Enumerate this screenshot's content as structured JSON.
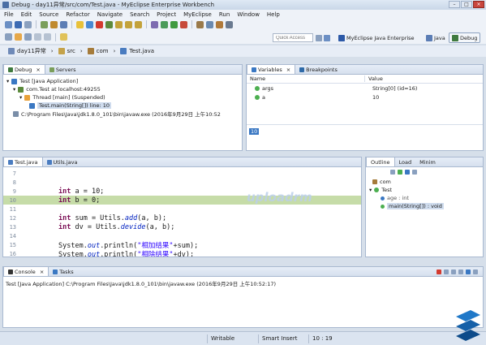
{
  "window": {
    "title": "Debug - day11异常/src/com/Test.java - MyEclipse Enterprise Workbench",
    "controls": [
      "–",
      "□",
      "×"
    ]
  },
  "menu": [
    "File",
    "Edit",
    "Source",
    "Refactor",
    "Navigate",
    "Search",
    "Project",
    "MyEclipse",
    "Run",
    "Window",
    "Help"
  ],
  "quick_access": {
    "placeholder": "Quick Access"
  },
  "perspectives": [
    {
      "label": "MyEclipse Java Enterprise"
    },
    {
      "label": "Java"
    },
    {
      "label": "Debug"
    }
  ],
  "breadcrumb": [
    "day11异常",
    "src",
    "com",
    "Test.java"
  ],
  "debug_view": {
    "tabs": [
      "Debug",
      "Servers"
    ],
    "tree": [
      {
        "label": "Test [Java Application]"
      },
      {
        "label": "com.Test at localhost:49255"
      },
      {
        "label": "Thread [main] (Suspended)"
      },
      {
        "label": "Test.main(String[]) line: 10"
      },
      {
        "label": "C:\\Program Files\\Java\\jdk1.8.0_101\\bin\\javaw.exe (2016年9月29日 上午10:52"
      }
    ]
  },
  "variables_view": {
    "tabs": [
      "Variables",
      "Breakpoints"
    ],
    "columns": [
      "Name",
      "Value"
    ],
    "rows": [
      {
        "name": "args",
        "value": "String[0]  (id=16)"
      },
      {
        "name": "a",
        "value": "10"
      }
    ],
    "detail_value": "10"
  },
  "editor": {
    "tabs": [
      "Test.java",
      "Utils.java"
    ],
    "lines": [
      {
        "num": "7",
        "parts": []
      },
      {
        "num": "8",
        "parts": []
      },
      {
        "num": "9",
        "parts": [
          {
            "t": "kw",
            "v": "int"
          },
          {
            "t": "txt",
            "v": " a = 10;"
          }
        ]
      },
      {
        "num": "10",
        "parts": [
          {
            "t": "kw",
            "v": "int"
          },
          {
            "t": "txt",
            "v": " b = 0;"
          }
        ],
        "current": true
      },
      {
        "num": "11",
        "parts": []
      },
      {
        "num": "12",
        "parts": [
          {
            "t": "kw",
            "v": "int"
          },
          {
            "t": "txt",
            "v": " sum = Utils."
          },
          {
            "t": "it",
            "v": "add"
          },
          {
            "t": "txt",
            "v": "(a, b);"
          }
        ]
      },
      {
        "num": "13",
        "parts": [
          {
            "t": "kw",
            "v": "int"
          },
          {
            "t": "txt",
            "v": " dv  = Utils."
          },
          {
            "t": "it",
            "v": "devide"
          },
          {
            "t": "txt",
            "v": "(a, b);"
          }
        ]
      },
      {
        "num": "14",
        "parts": []
      },
      {
        "num": "15",
        "parts": [
          {
            "t": "txt",
            "v": "System."
          },
          {
            "t": "it",
            "v": "out"
          },
          {
            "t": "txt",
            "v": ".println("
          },
          {
            "t": "str",
            "v": "\"相加结果\""
          },
          {
            "t": "txt",
            "v": "+sum);"
          }
        ]
      },
      {
        "num": "16",
        "parts": [
          {
            "t": "txt",
            "v": "System."
          },
          {
            "t": "it",
            "v": "out"
          },
          {
            "t": "txt",
            "v": ".println("
          },
          {
            "t": "str",
            "v": "\"相除结果\""
          },
          {
            "t": "txt",
            "v": "+dv);"
          }
        ]
      }
    ]
  },
  "outline_view": {
    "tabs": [
      "Outline",
      "Load",
      "Minim"
    ],
    "tree": [
      {
        "label": "com",
        "color": "#4caf50"
      },
      {
        "label": "Test",
        "color": "#4caf50"
      },
      {
        "label": "age : int",
        "color": "#3a78c3"
      },
      {
        "label": "main(String[]) : void",
        "color": "#4caf50"
      }
    ]
  },
  "console_view": {
    "tabs": [
      "Console",
      "Tasks"
    ],
    "header": "Test [Java Application] C:\\Program Files\\Java\\jdk1.8.0_101\\bin\\javaw.exe (2016年9月29日 上午10:52:17)"
  },
  "status": {
    "mode": "Writable",
    "insert": "Smart Insert",
    "position": "10 : 19"
  },
  "watermark": "uploadrm"
}
